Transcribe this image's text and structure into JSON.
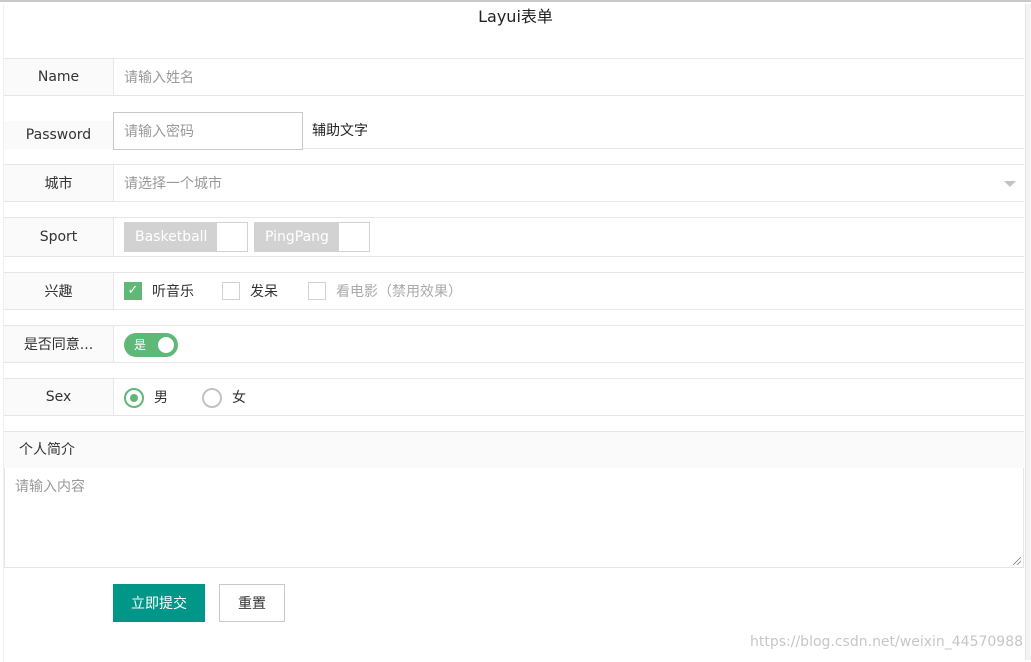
{
  "form": {
    "title": "Layui表单",
    "name": {
      "label": "Name",
      "placeholder": "请输入姓名"
    },
    "password": {
      "label": "Password",
      "placeholder": "请输入密码",
      "aux_text": "辅助文字"
    },
    "city": {
      "label": "城市",
      "placeholder": "请选择一个城市"
    },
    "sport": {
      "label": "Sport",
      "options": [
        "Basketball",
        "PingPang"
      ]
    },
    "hobby": {
      "label": "兴趣",
      "options": [
        {
          "text": "听音乐",
          "checked": true,
          "disabled": false
        },
        {
          "text": "发呆",
          "checked": false,
          "disabled": false
        },
        {
          "text": "看电影（禁用效果）",
          "checked": false,
          "disabled": true
        }
      ]
    },
    "agree": {
      "label": "是否同意...",
      "switch_text": "是",
      "on": true
    },
    "sex": {
      "label": "Sex",
      "options": [
        {
          "text": "男",
          "checked": true
        },
        {
          "text": "女",
          "checked": false
        }
      ]
    },
    "intro": {
      "label": "个人简介",
      "placeholder": "请输入内容"
    },
    "buttons": {
      "submit": "立即提交",
      "reset": "重置"
    }
  },
  "watermark": "https://blog.csdn.net/weixin_44570988",
  "colors": {
    "accent_green": "#5fb878",
    "primary_button": "#009688"
  }
}
